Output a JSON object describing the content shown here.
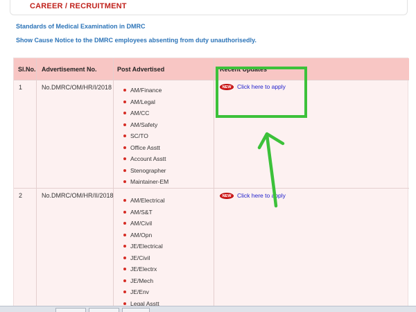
{
  "header": {
    "title": "CAREER / RECRUITMENT"
  },
  "notices": [
    "Standards of Medical Examination in DMRC",
    "Show Cause Notice to the DMRC employees absenting from duty unauthorisedly."
  ],
  "table": {
    "columns": [
      "Sl.No.",
      "Advertisement No.",
      "Post Advertised",
      "Recent Updates"
    ],
    "rows": [
      {
        "sl_no": "1",
        "adv_no": "No.DMRC/OM/HR/I/2018",
        "posts": [
          "AM/Finance",
          "AM/Legal",
          "AM/CC",
          "AM/Safety",
          "SC/TO",
          "Office Asstt",
          "Account Asstt",
          "Stenographer",
          "Maintainer-EM"
        ],
        "badge": "NEW",
        "update_link": "Click here to apply"
      },
      {
        "sl_no": "2",
        "adv_no": "No.DMRC/OM/HR/II/2018",
        "posts": [
          "AM/Electrical",
          "AM/S&T",
          "AM/Civil",
          "AM/Opn",
          "JE/Electrical",
          "JE/Civil",
          "JE/Electrx",
          "JE/Mech",
          "JE/Env",
          "Legal Asstt"
        ],
        "badge": "NEW",
        "update_link": "Click here to apply"
      }
    ]
  },
  "annotation": {
    "color": "#3cc13a"
  }
}
